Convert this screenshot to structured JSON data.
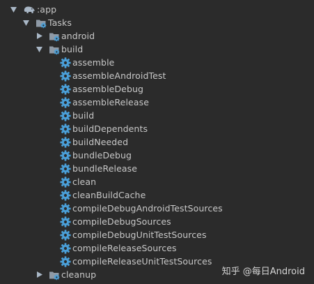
{
  "tree": {
    "module_label": ":app",
    "tasks_label": "Tasks",
    "groups": {
      "android": "android",
      "build": "build",
      "cleanup": "cleanup"
    },
    "build_tasks": [
      "assemble",
      "assembleAndroidTest",
      "assembleDebug",
      "assembleRelease",
      "build",
      "buildDependents",
      "buildNeeded",
      "bundleDebug",
      "bundleRelease",
      "clean",
      "cleanBuildCache",
      "compileDebugAndroidTestSources",
      "compileDebugSources",
      "compileDebugUnitTestSources",
      "compileReleaseSources",
      "compileReleaseUnitTestSources"
    ]
  },
  "watermark": "知乎 @每日Android",
  "colors": {
    "background": "#2b2b2b",
    "text": "#c8c8c8",
    "gear": "#4a9fd8",
    "folder": "#8f9aa6"
  },
  "icons": {
    "expanded": "triangle-down-icon",
    "collapsed": "triangle-right-icon",
    "module": "gradle-elephant-icon",
    "task_folder": "gear-folder-icon",
    "task": "gear-icon"
  }
}
